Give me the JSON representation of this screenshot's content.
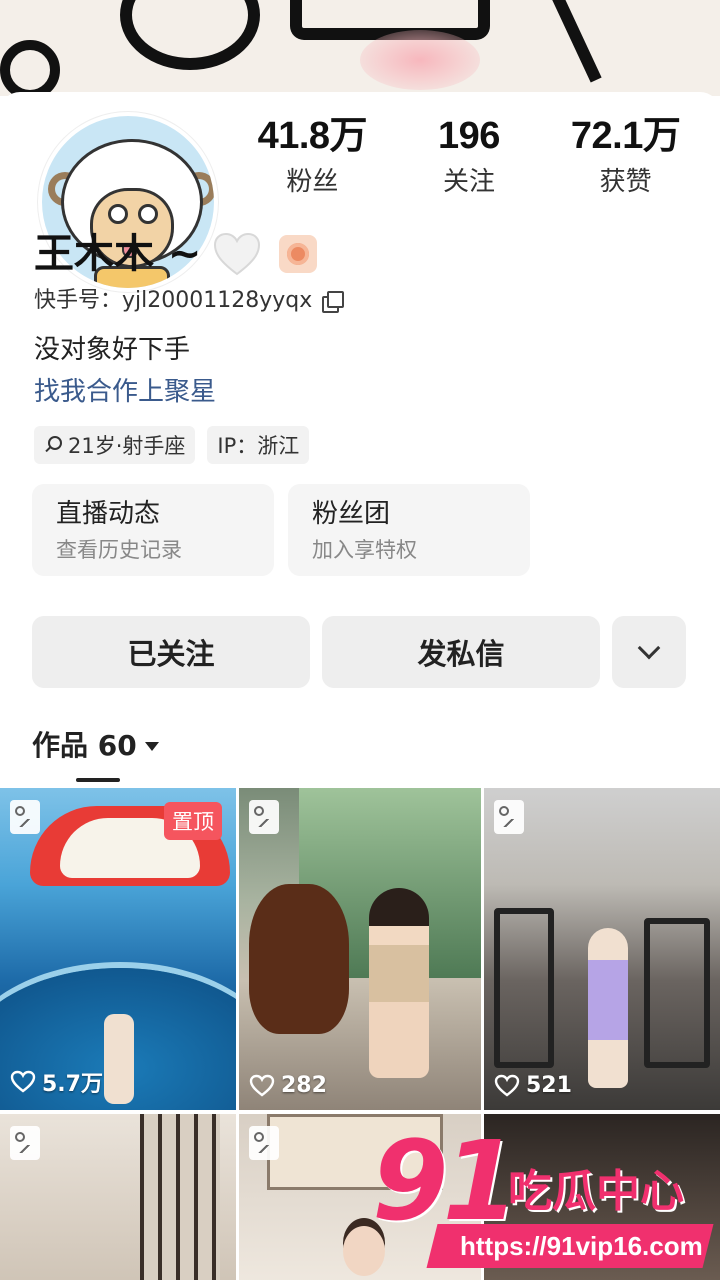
{
  "profile": {
    "name": "王木木 ~",
    "kuaishou_id": "快手号：yjl20001128yyqx",
    "bio": "没对象好下手",
    "link_text": "找我合作上聚星"
  },
  "stats": [
    {
      "value": "41.8万",
      "label": "粉丝"
    },
    {
      "value": "196",
      "label": "关注"
    },
    {
      "value": "72.1万",
      "label": "获赞"
    }
  ],
  "tags": [
    "21岁·射手座",
    "IP：浙江"
  ],
  "cards": [
    {
      "title": "直播动态",
      "subtitle": "查看历史记录"
    },
    {
      "title": "粉丝团",
      "subtitle": "加入享特权"
    }
  ],
  "actions": {
    "follow_label": "已关注",
    "message_label": "发私信"
  },
  "works_tab": {
    "label": "作品 60"
  },
  "grid": [
    {
      "likes": "5.7万",
      "pinned": "置顶"
    },
    {
      "likes": "282"
    },
    {
      "likes": "521"
    }
  ],
  "watermark": {
    "logo": "91",
    "text": "吃瓜中心",
    "url": "https://91vip16.com"
  },
  "icons": {
    "heart": "heart-icon",
    "badge": "badge-icon",
    "copy": "copy-icon",
    "location": "location-pin-icon",
    "chevron": "chevron-down-icon",
    "image": "image-icon",
    "like": "heart-outline-icon"
  },
  "colors": {
    "link": "#3a5a8c",
    "pinned_badge": "#f5555e",
    "watermark": "#f0306e"
  }
}
